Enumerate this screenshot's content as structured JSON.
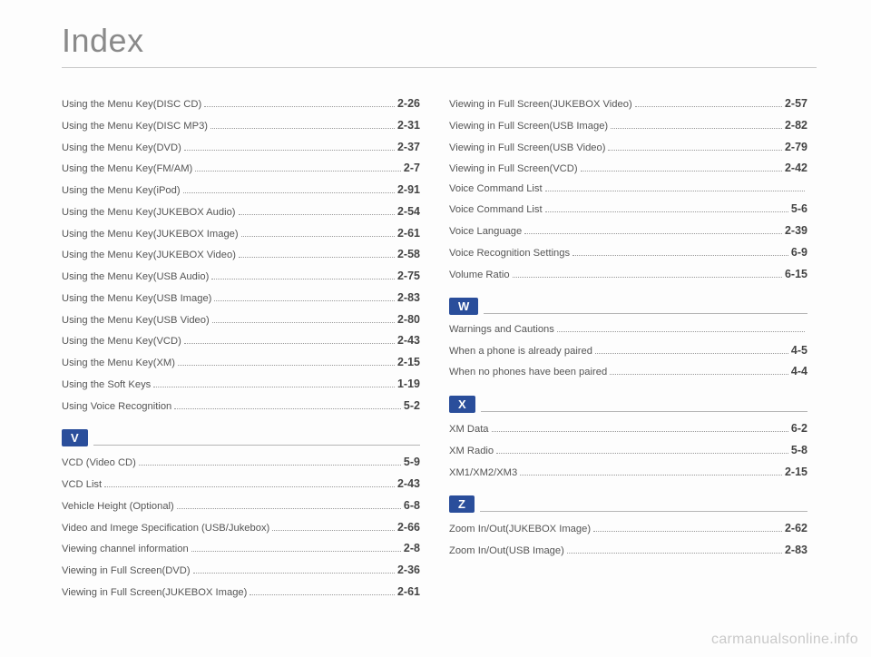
{
  "title": "Index",
  "watermark": "carmanualsonline.info",
  "left": {
    "topEntries": [
      {
        "label": "Using the Menu Key(DISC CD)",
        "page": "2-26"
      },
      {
        "label": "Using the Menu Key(DISC MP3)",
        "page": "2-31"
      },
      {
        "label": "Using the Menu Key(DVD)",
        "page": "2-37"
      },
      {
        "label": "Using the Menu Key(FM/AM)",
        "page": "2-7"
      },
      {
        "label": "Using the Menu Key(iPod)",
        "page": "2-91"
      },
      {
        "label": "Using the Menu Key(JUKEBOX Audio)",
        "page": "2-54"
      },
      {
        "label": "Using the Menu Key(JUKEBOX Image)",
        "page": "2-61"
      },
      {
        "label": "Using the Menu Key(JUKEBOX Video)",
        "page": "2-58"
      },
      {
        "label": "Using the Menu Key(USB Audio)",
        "page": "2-75"
      },
      {
        "label": "Using the Menu Key(USB Image)",
        "page": "2-83"
      },
      {
        "label": "Using the Menu Key(USB Video)",
        "page": "2-80"
      },
      {
        "label": "Using the Menu Key(VCD)",
        "page": "2-43"
      },
      {
        "label": "Using the Menu Key(XM)",
        "page": "2-15"
      },
      {
        "label": "Using the Soft Keys",
        "page": "1-19"
      },
      {
        "label": "Using Voice Recognition",
        "page": "5-2"
      }
    ],
    "sections": [
      {
        "letter": "V",
        "entries": [
          {
            "label": "VCD (Video CD)",
            "page": "5-9"
          },
          {
            "label": "VCD List",
            "page": "2-43"
          },
          {
            "label": "Vehicle Height (Optional)",
            "page": "6-8"
          },
          {
            "label": "Video and Imege Specification (USB/Jukebox)",
            "page": "2-66"
          },
          {
            "label": "Viewing channel information",
            "page": "2-8"
          },
          {
            "label": "Viewing in Full Screen(DVD)",
            "page": "2-36"
          },
          {
            "label": "Viewing in Full Screen(JUKEBOX Image)",
            "page": "2-61"
          }
        ]
      }
    ]
  },
  "right": {
    "topEntries": [
      {
        "label": "Viewing in Full Screen(JUKEBOX Video)",
        "page": "2-57"
      },
      {
        "label": "Viewing in Full Screen(USB Image)",
        "page": "2-82"
      },
      {
        "label": "Viewing in Full Screen(USB Video)",
        "page": "2-79"
      },
      {
        "label": "Viewing in Full Screen(VCD)",
        "page": "2-42"
      },
      {
        "label": "Voice Command List",
        "page": ""
      },
      {
        "label": "Voice Command List ",
        "page": "5-6"
      },
      {
        "label": "Voice Language",
        "page": "2-39"
      },
      {
        "label": "Voice Recognition Settings",
        "page": "6-9"
      },
      {
        "label": "Volume Ratio",
        "page": "6-15"
      }
    ],
    "sections": [
      {
        "letter": "W",
        "entries": [
          {
            "label": "Warnings and Cautions",
            "page": ""
          },
          {
            "label": "When a phone is already paired",
            "page": "4-5"
          },
          {
            "label": "When no phones have been paired",
            "page": "4-4"
          }
        ]
      },
      {
        "letter": "X",
        "entries": [
          {
            "label": "XM Data",
            "page": "6-2"
          },
          {
            "label": "XM Radio",
            "page": "5-8"
          },
          {
            "label": "XM1/XM2/XM3",
            "page": "2-15"
          }
        ]
      },
      {
        "letter": "Z",
        "entries": [
          {
            "label": "Zoom In/Out(JUKEBOX Image)",
            "page": "2-62"
          },
          {
            "label": "Zoom In/Out(USB Image)",
            "page": "2-83"
          }
        ]
      }
    ]
  }
}
